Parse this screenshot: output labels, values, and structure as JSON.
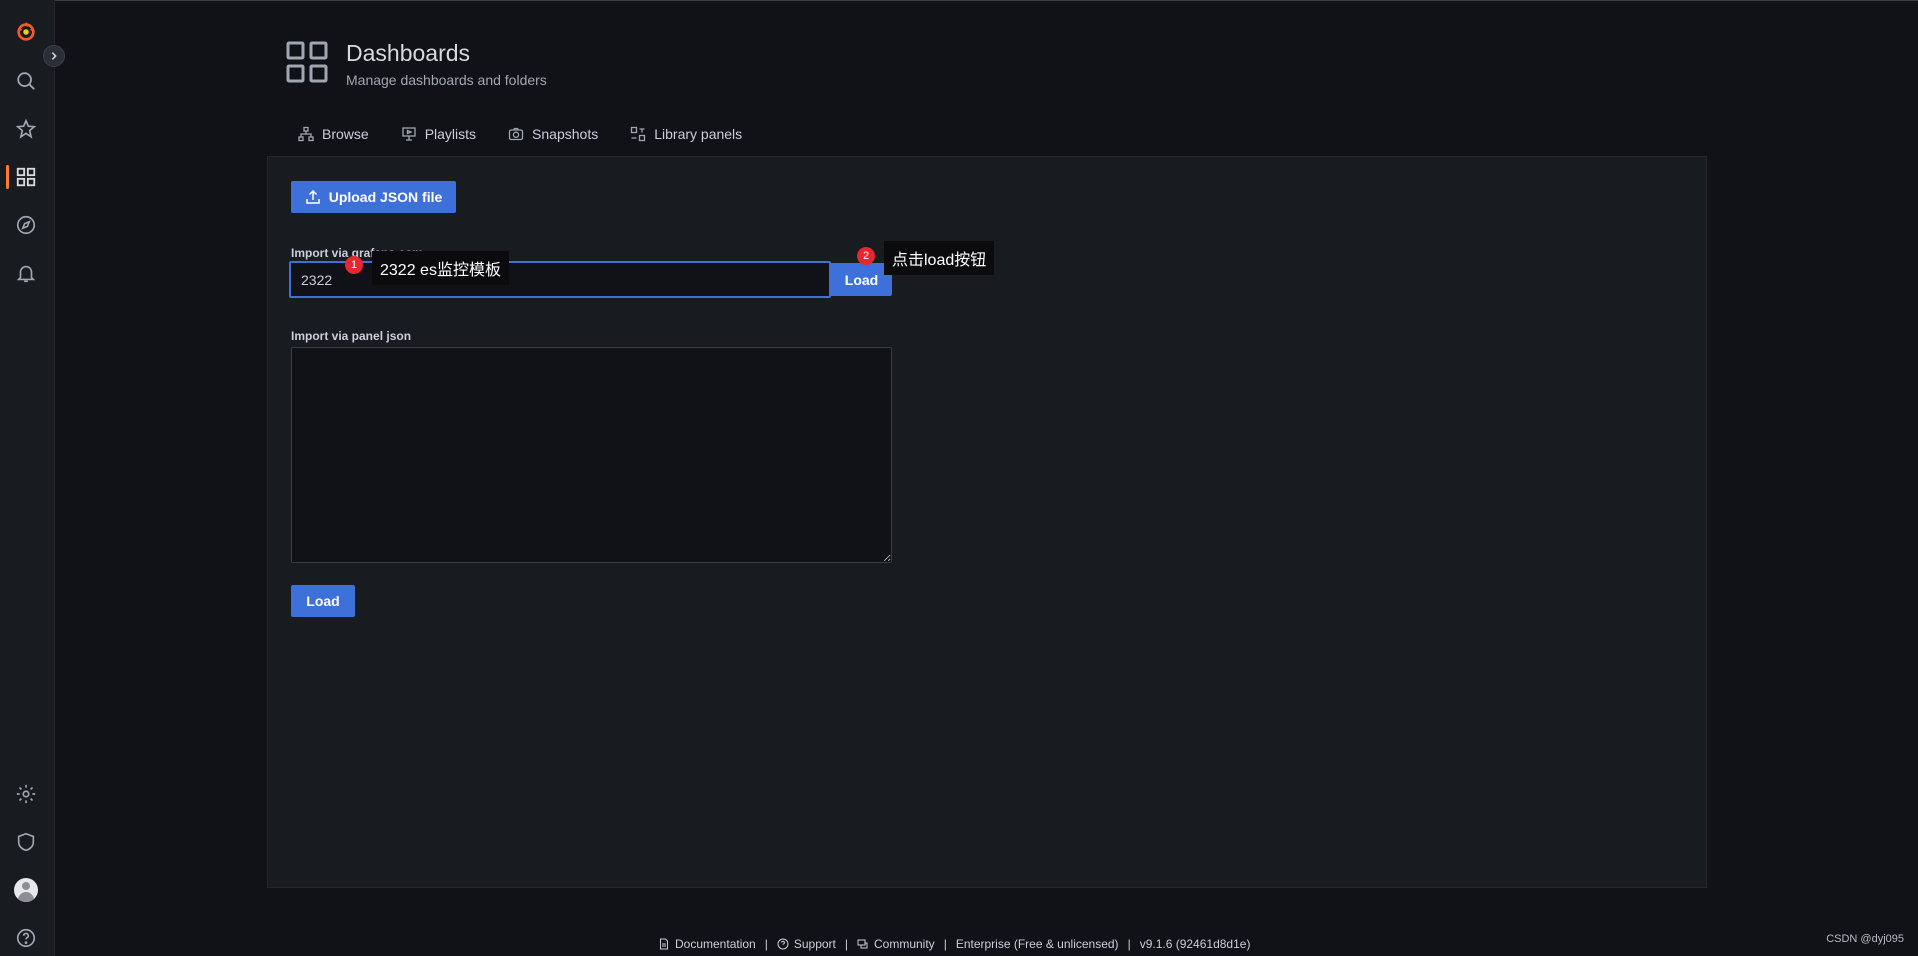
{
  "header": {
    "title": "Dashboards",
    "subtitle": "Manage dashboards and folders"
  },
  "sidebar": {
    "items": [
      {
        "icon": "grafana-logo"
      },
      {
        "icon": "search-icon"
      },
      {
        "icon": "star-icon"
      },
      {
        "icon": "dashboards-icon",
        "active": true
      },
      {
        "icon": "explore-icon"
      },
      {
        "icon": "bell-icon"
      },
      {
        "icon": "gear-icon"
      },
      {
        "icon": "shield-icon"
      },
      {
        "icon": "avatar"
      },
      {
        "icon": "help-icon"
      }
    ],
    "active_color": "#ff7d2e"
  },
  "tabs": [
    {
      "label": "Browse",
      "icon": "sitemap-icon"
    },
    {
      "label": "Playlists",
      "icon": "presentation-icon"
    },
    {
      "label": "Snapshots",
      "icon": "camera-icon"
    },
    {
      "label": "Library panels",
      "icon": "library-panels-icon"
    }
  ],
  "import": {
    "upload_label": "Upload JSON file",
    "grafana_label": "Import via grafana.com",
    "grafana_value": "2322",
    "load_label": "Load",
    "panel_json_label": "Import via panel json",
    "panel_json_value": "",
    "load_label_2": "Load"
  },
  "annotations": [
    {
      "number": "1",
      "text": "2322 es监控模板"
    },
    {
      "number": "2",
      "text": "点击load按钮"
    }
  ],
  "footer": {
    "documentation": "Documentation",
    "support": "Support",
    "community": "Community",
    "edition": "Enterprise (Free & unlicensed)",
    "version": "v9.1.6 (92461d8d1e)"
  },
  "watermark": "CSDN @dyj095",
  "colors": {
    "accent": "#3d71d9",
    "background": "#111217",
    "panel": "#181b1f",
    "annotation_badge": "#e8262f"
  }
}
